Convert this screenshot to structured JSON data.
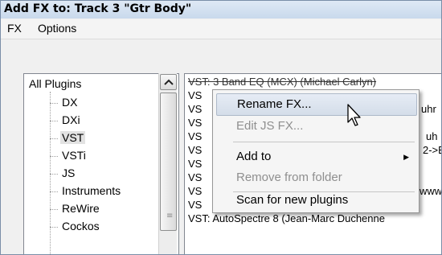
{
  "window": {
    "title": "Add FX to: Track 3 \"Gtr Body\""
  },
  "menubar": {
    "fx": "FX",
    "options": "Options"
  },
  "tree": {
    "root": "All Plugins",
    "items": [
      {
        "label": "DX"
      },
      {
        "label": "DXi"
      },
      {
        "label": "VST",
        "selected": true
      },
      {
        "label": "VSTi"
      },
      {
        "label": "JS"
      },
      {
        "label": "Instruments"
      },
      {
        "label": "ReWire"
      },
      {
        "label": "Cockos"
      }
    ],
    "scroll_up_icon": "chevron-up-icon"
  },
  "plugin_list": {
    "rows": [
      "VST: 3 Band EQ (MCX) (Michael Carlyn)",
      "VS",
      "VS",
      "VS",
      "VS",
      "VS",
      "VS",
      "VS",
      "VS",
      "VS",
      "VST: AutoSpectre 8 (Jean-Marc Duchenne"
    ],
    "row_fragments": [
      "",
      "",
      "uhr",
      "",
      "uh",
      "2->E",
      "",
      "",
      "www",
      "",
      ""
    ]
  },
  "context_menu": {
    "items": [
      {
        "label": "Rename FX...",
        "highlighted": true,
        "disabled": false
      },
      {
        "label": "Edit JS FX...",
        "disabled": true
      },
      {
        "label": "Add to",
        "submenu": true,
        "disabled": false
      },
      {
        "label": "Remove from folder",
        "disabled": true
      },
      {
        "label": "Scan for new plugins",
        "disabled": false
      }
    ]
  },
  "colors": {
    "title_bar": "#c9d9ec",
    "highlight": "#d4dde9",
    "disabled_text": "#8f8f8f"
  }
}
